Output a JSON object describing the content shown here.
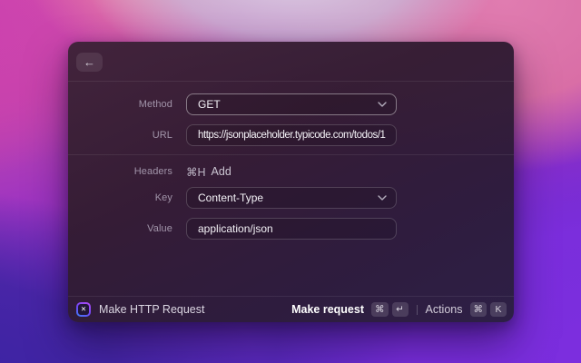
{
  "header": {
    "back_glyph": "←"
  },
  "form": {
    "method_label": "Method",
    "method_value": "GET",
    "url_label": "URL",
    "url_value": "https://jsonplaceholder.typicode.com/todos/1",
    "headers_label": "Headers",
    "headers_shortcut": "⌘H",
    "headers_action": "Add",
    "key_label": "Key",
    "key_value": "Content-Type",
    "value_label": "Value",
    "value_value": "application/json"
  },
  "footer": {
    "app_title": "Make HTTP Request",
    "extension_icon_glyph": "✕",
    "primary_label": "Make request",
    "primary_key_1": "⌘",
    "primary_key_2": "↵",
    "secondary_label": "Actions",
    "secondary_key_1": "⌘",
    "secondary_key_2": "K"
  },
  "colors": {
    "focused_field_border": "rgba(255,255,255,0.42)",
    "field_border": "rgba(255,255,255,0.18)",
    "window_tint_top": "#40233a",
    "window_tint_bottom": "#2b1f42",
    "wallpaper_pink": "#d96ea6",
    "wallpaper_magenta": "#cb3fae",
    "wallpaper_violet": "#7e2ee0",
    "wallpaper_indigo": "#3a22a2"
  }
}
